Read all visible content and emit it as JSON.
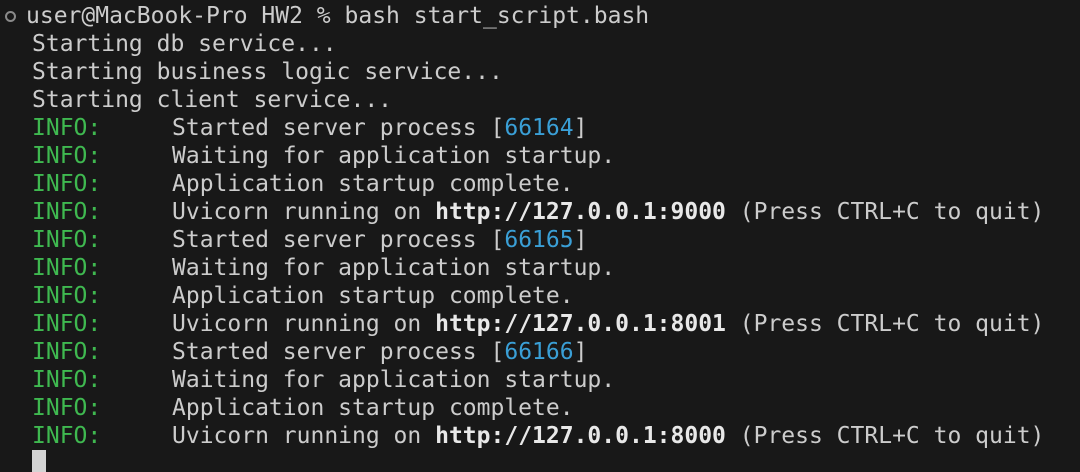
{
  "prompt": {
    "context": "user@MacBook-Pro HW2 % ",
    "command": "bash start_script.bash"
  },
  "startup_messages": [
    "Starting db service...",
    "Starting business logic service...",
    "Starting client service..."
  ],
  "log": {
    "level_label": "INFO:",
    "started_prefix": "Started server process [",
    "started_suffix": "]",
    "waiting": "Waiting for application startup.",
    "complete": "Application startup complete.",
    "running_prefix": "Uvicorn running on ",
    "running_suffix": " (Press CTRL+C to quit)",
    "servers": [
      {
        "pid": "66164",
        "url": "http://127.0.0.1:9000"
      },
      {
        "pid": "66165",
        "url": "http://127.0.0.1:8001"
      },
      {
        "pid": "66166",
        "url": "http://127.0.0.1:8000"
      }
    ]
  },
  "colors": {
    "background": "#181818",
    "text": "#cccccc",
    "info": "#3fb950",
    "pid": "#3a9fd6"
  }
}
